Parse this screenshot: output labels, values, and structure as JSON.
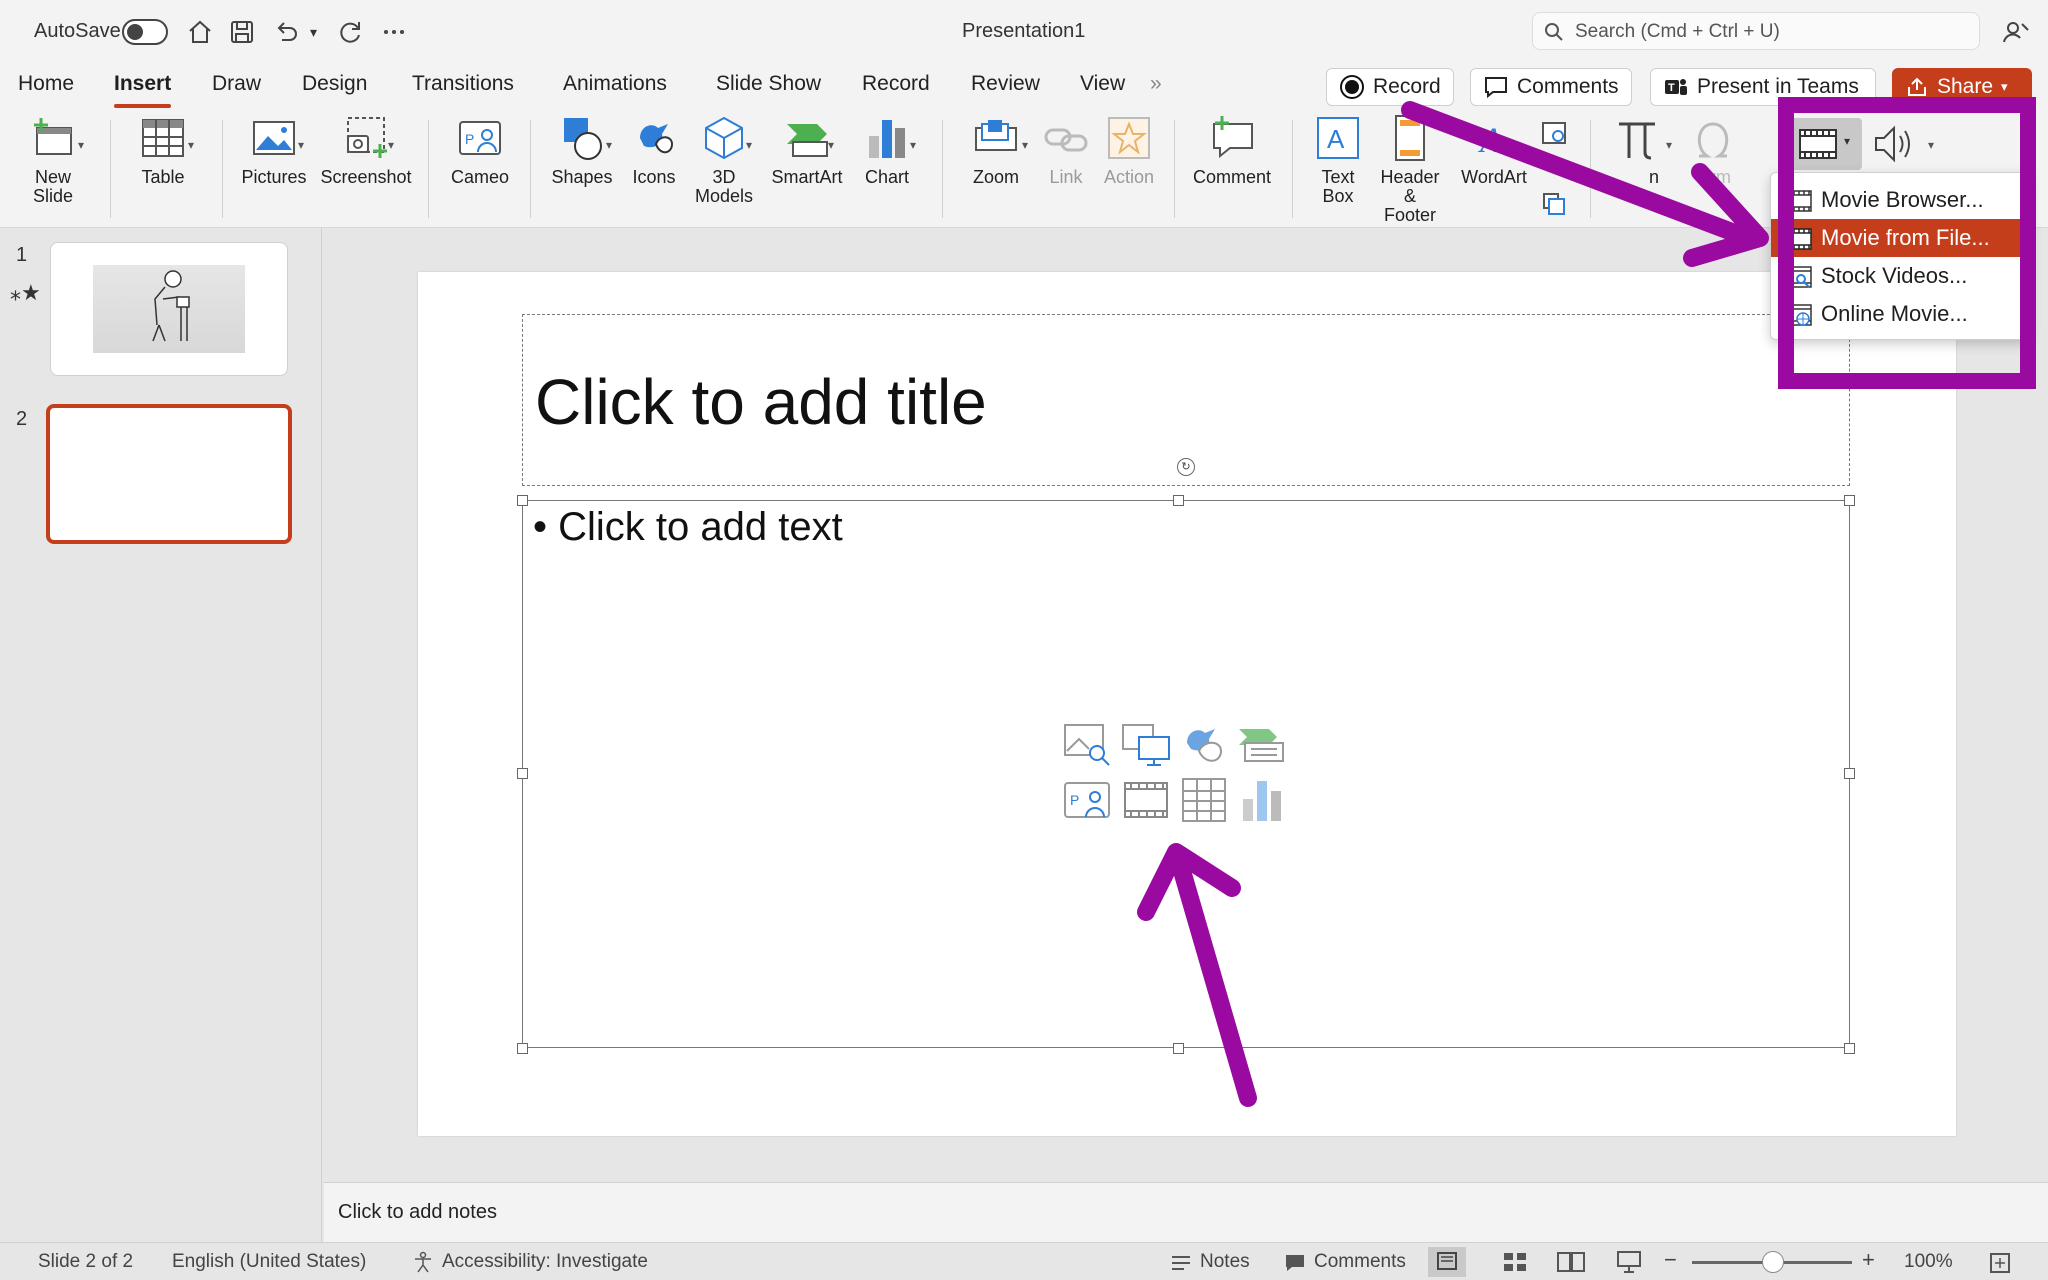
{
  "titlebar": {
    "autosave_label": "AutoSave",
    "document_title": "Presentation1",
    "search_placeholder": "Search (Cmd + Ctrl + U)"
  },
  "tabs": [
    "Home",
    "Insert",
    "Draw",
    "Design",
    "Transitions",
    "Animations",
    "Slide Show",
    "Record",
    "Review",
    "View"
  ],
  "active_tab": "Insert",
  "actions": {
    "record_label": "Record",
    "comments_label": "Comments",
    "present_label": "Present in Teams",
    "share_label": "Share"
  },
  "ribbon": {
    "new_slide": "New\nSlide",
    "table": "Table",
    "pictures": "Pictures",
    "screenshot": "Screenshot",
    "cameo": "Cameo",
    "shapes": "Shapes",
    "icons": "Icons",
    "models_3d": "3D\nModels",
    "smartart": "SmartArt",
    "chart": "Chart",
    "zoom": "Zoom",
    "link": "Link",
    "action": "Action",
    "comment": "Comment",
    "text_box": "Text\nBox",
    "header_footer": "Header &\nFooter",
    "wordart": "WordArt",
    "equation_partial": "n",
    "symbol_partial": "Sym"
  },
  "slides_panel": {
    "slides": [
      {
        "number": "1",
        "has_animation": true
      },
      {
        "number": "2",
        "selected": true
      }
    ]
  },
  "slide": {
    "title_placeholder": "Click to add title",
    "body_placeholder": "• Click to add text"
  },
  "notes": {
    "placeholder": "Click to add notes"
  },
  "status": {
    "slide_counter": "Slide 2 of 2",
    "language": "English (United States)",
    "accessibility": "Accessibility: Investigate",
    "notes_label": "Notes",
    "comments_label": "Comments",
    "zoom_level": "100%",
    "zoom_fraction": 0.5
  },
  "movie_menu": {
    "items": [
      {
        "label": "Movie Browser...",
        "icon": "film-icon"
      },
      {
        "label": "Movie from File...",
        "icon": "film-icon",
        "highlighted": true
      },
      {
        "label": "Stock Videos...",
        "icon": "film-search-icon"
      },
      {
        "label": "Online Movie...",
        "icon": "film-globe-icon"
      }
    ]
  },
  "colors": {
    "accent": "#c43e1c",
    "annotation": "#9b0aa0",
    "ribbon_blue": "#2e7dd6",
    "ribbon_green": "#4caf50"
  }
}
